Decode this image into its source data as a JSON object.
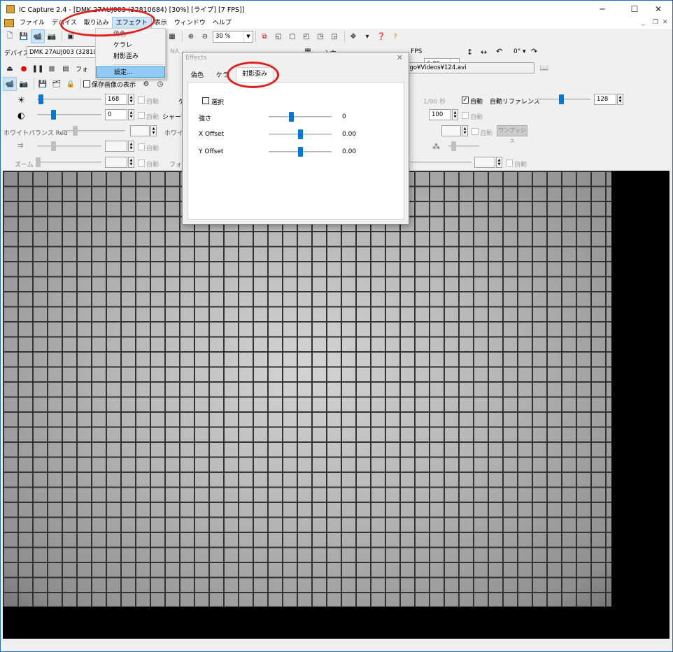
{
  "window": {
    "title": "IC Capture 2.4 - [DMK 27AUJ003 (32810684) [30%] [ライブ] [7 FPS]]",
    "minimize": "─",
    "maximize": "☐",
    "close": "✕"
  },
  "menu": [
    "ファイル",
    "デバイス",
    "取り込み",
    "エフェクト",
    "表示",
    "ウィンドウ",
    "ヘルプ"
  ],
  "mdi": {
    "minimize": "_",
    "restore": "❐",
    "close": "✕"
  },
  "effects_menu": {
    "items": [
      "偽色",
      "ケラレ",
      "射影歪み",
      "設定..."
    ]
  },
  "toolbar1": {
    "zoom": "30 %"
  },
  "device_bar": {
    "device_label": "デバイス",
    "device": "DMK 27AUJ003 (32810684",
    "format_partial": "NA",
    "input_label": "入力",
    "fps_label": "FPS",
    "fps": "6.85",
    "rotation": "0°"
  },
  "capture_bar": {
    "format_label": "フォ",
    "file": "rgo¥Videos¥124.avi"
  },
  "tools_bar": {
    "show_saved": "保存画像の表示"
  },
  "props": {
    "brightness": "168",
    "contrast": "0",
    "auto": "自動",
    "sharpness_label": "シャープ",
    "gain_partial": "ゲ",
    "exposure": "1/90 秒",
    "auto_reference_label": "自動リファレンス",
    "auto_reference": "128",
    "gamma": "100",
    "wb_red_label": "ホワイトバランス Red",
    "wb_partial": "ホワイ",
    "one_push": "ワンプッシュ",
    "zoom_label": "ズーム",
    "focus_partial": "フォー"
  },
  "dialog": {
    "title": "Effects",
    "close": "✕",
    "tabs": [
      "偽色",
      "ケラ",
      "射影歪み"
    ],
    "enable_label": "選択",
    "rows": [
      {
        "label": "強さ",
        "value": "0",
        "level": 0.35
      },
      {
        "label": "X Offset",
        "value": "0.00",
        "level": 0.5
      },
      {
        "label": "Y Offset",
        "value": "0.00",
        "level": 0.5
      }
    ]
  },
  "colors": {
    "accent": "#0078d7",
    "annotation_ring": "#e0201c",
    "menu_highlight": "#cce4f7"
  }
}
